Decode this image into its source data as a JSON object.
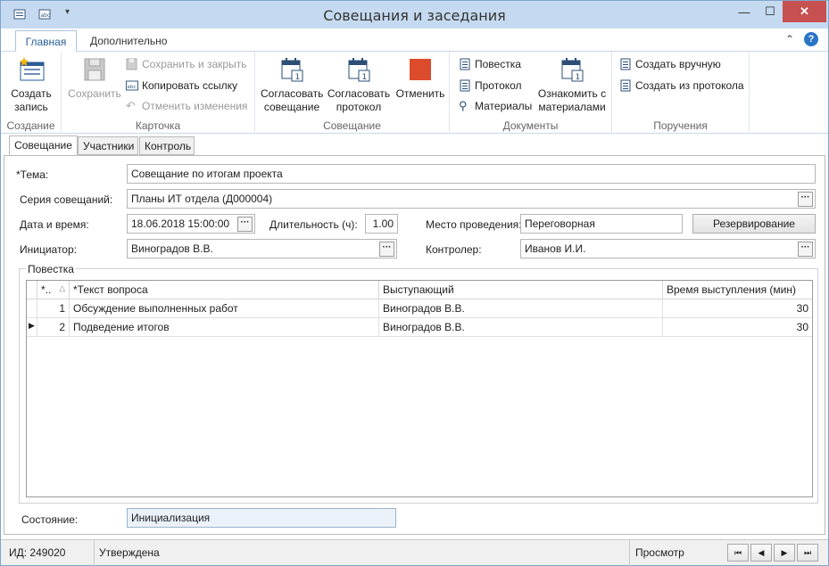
{
  "window": {
    "title": "Совещания и заседания"
  },
  "ribbon": {
    "tabs": [
      "Главная",
      "Дополнительно"
    ],
    "groups": {
      "create": {
        "label": "Создание",
        "create_btn": "Создать запись"
      },
      "card": {
        "label": "Карточка",
        "save": "Сохранить",
        "save_close": "Сохранить и закрыть",
        "copy_link": "Копировать ссылку",
        "undo": "Отменить изменения"
      },
      "meeting": {
        "label": "Совещание",
        "approve_meeting": "Согласовать совещание",
        "approve_protocol": "Согласовать протокол",
        "cancel": "Отменить"
      },
      "documents": {
        "label": "Документы",
        "agenda": "Повестка",
        "protocol": "Протокол",
        "materials": "Материалы",
        "review": "Ознакомить с материалами"
      },
      "tasks": {
        "label": "Поручения",
        "manual": "Создать вручную",
        "from_protocol": "Создать из протокола"
      }
    }
  },
  "tabs": [
    "Совещание",
    "Участники",
    "Контроль"
  ],
  "form": {
    "topic_label": "*Тема:",
    "topic": "Совещание по итогам проекта",
    "series_label": "Серия совещаний:",
    "series": "Планы ИТ отдела (Д000004)",
    "datetime_label": "Дата и время:",
    "datetime": "18.06.2018 15:00:00",
    "duration_label": "Длительность (ч):",
    "duration": "1.00",
    "place_label": "Место проведения:",
    "place": "Переговорная",
    "reserve": "Резервирование",
    "initiator_label": "Инициатор:",
    "initiator": "Виноградов В.В.",
    "controller_label": "Контролер:",
    "controller": "Иванов И.И.",
    "state_label": "Состояние:",
    "state": "Инициализация"
  },
  "agenda": {
    "legend": "Повестка",
    "columns": [
      "*..",
      "*Текст вопроса",
      "Выступающий",
      "Время выступления (мин)"
    ],
    "rows": [
      {
        "n": "1",
        "text": "Обсуждение выполненных работ",
        "speaker": "Виноградов В.В.",
        "time": "30"
      },
      {
        "n": "2",
        "text": "Подведение итогов",
        "speaker": "Виноградов В.В.",
        "time": "30"
      }
    ]
  },
  "status": {
    "id": "ИД: 249020",
    "state": "Утверждена",
    "mode": "Просмотр"
  }
}
